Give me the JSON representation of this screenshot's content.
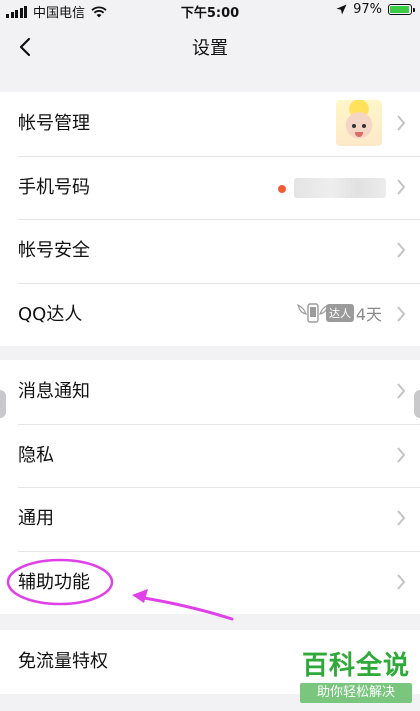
{
  "status_bar": {
    "carrier": "中国电信",
    "time": "下午5:00",
    "battery_percent": "97%",
    "battery_level": 0.97,
    "battery_color": "#3bcb45"
  },
  "nav": {
    "title": "设置",
    "back_icon": "chevron-left-icon"
  },
  "groups": [
    {
      "rows": [
        {
          "label": "帐号管理",
          "accessory": "avatar"
        },
        {
          "label": "手机号码",
          "accessory": "red-dot-and-blurred-number"
        },
        {
          "label": "帐号安全"
        },
        {
          "label": "QQ达人",
          "badge": "达人",
          "days": "4天"
        }
      ]
    },
    {
      "rows": [
        {
          "label": "消息通知"
        },
        {
          "label": "隐私"
        },
        {
          "label": "通用"
        },
        {
          "label": "辅助功能",
          "highlighted": true
        }
      ]
    },
    {
      "rows": [
        {
          "label": "免流量特权"
        }
      ]
    }
  ],
  "annotation": {
    "color": "#e040e8",
    "target": "辅助功能"
  },
  "watermark": {
    "main": "百科全说",
    "sub": "助你轻松解决",
    "color": "#2faa3a"
  },
  "colors": {
    "background": "#f2f2f5",
    "row": "#ffffff",
    "separator": "#e5e5ea",
    "chevron": "#c4c4c8",
    "red_dot": "#f55a36"
  }
}
